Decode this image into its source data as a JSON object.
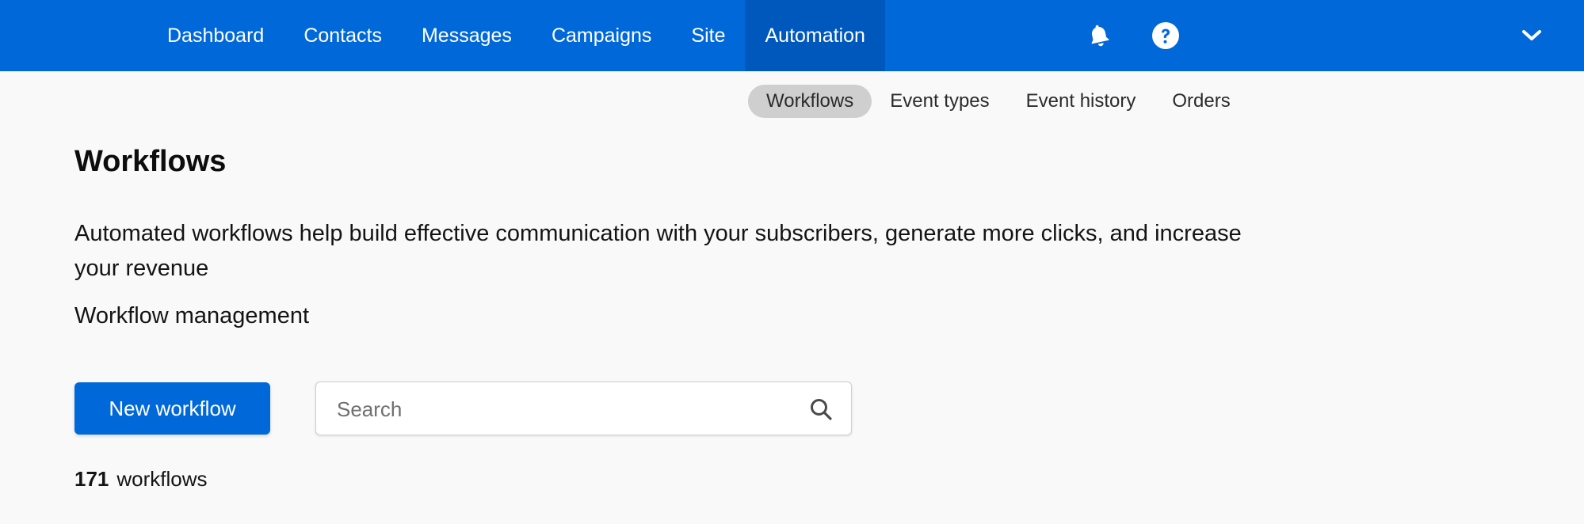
{
  "topnav": {
    "items": [
      {
        "label": "Dashboard",
        "active": false
      },
      {
        "label": "Contacts",
        "active": false
      },
      {
        "label": "Messages",
        "active": false
      },
      {
        "label": "Campaigns",
        "active": false
      },
      {
        "label": "Site",
        "active": false
      },
      {
        "label": "Automation",
        "active": true
      }
    ],
    "icons": [
      "bell-icon",
      "help-icon",
      "chevron-down-icon"
    ]
  },
  "subnav": {
    "items": [
      {
        "label": "Workflows",
        "active": true
      },
      {
        "label": "Event types",
        "active": false
      },
      {
        "label": "Event history",
        "active": false
      },
      {
        "label": "Orders",
        "active": false
      }
    ]
  },
  "main": {
    "title": "Workflows",
    "description": "Automated workflows help build effective communication with your subscribers, generate more clicks, and increase your revenue",
    "subheading": "Workflow management",
    "new_button_label": "New workflow",
    "search_placeholder": "Search",
    "workflow_count": "171",
    "workflow_count_label": "workflows"
  },
  "colors": {
    "brand_blue": "#0068d9",
    "active_nav_bg": "#0058bd",
    "active_subnav_bg": "#cfcfcf",
    "page_bg": "#f9f9f9"
  }
}
